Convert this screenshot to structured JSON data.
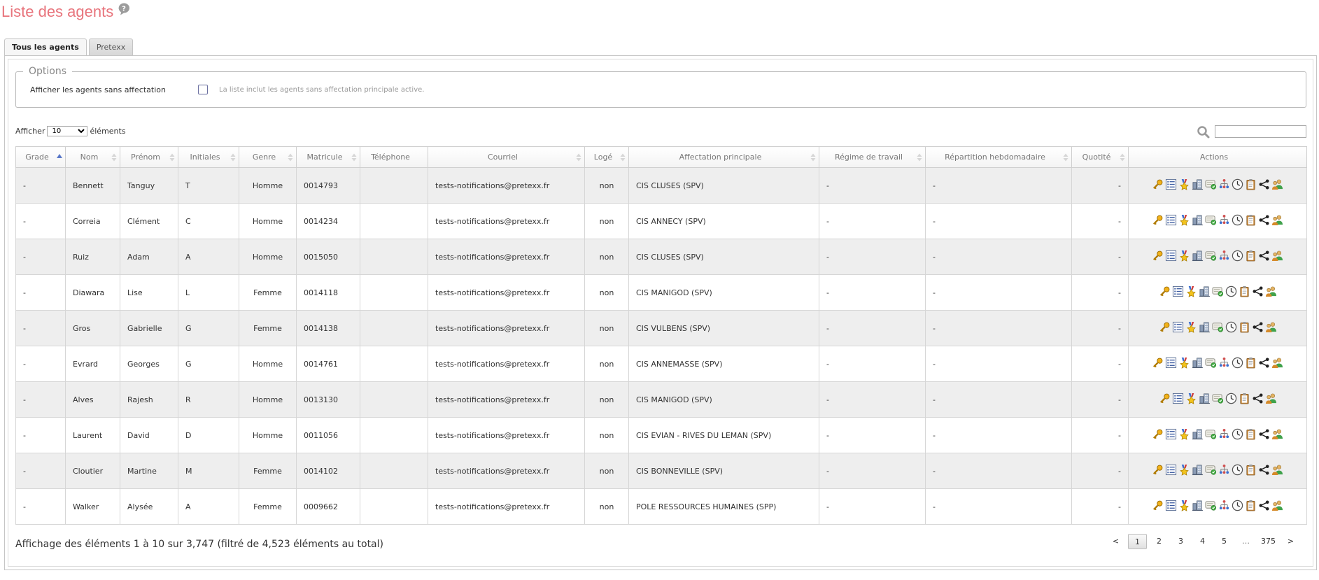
{
  "page": {
    "title": "Liste des agents"
  },
  "tabs": [
    "Tous les agents",
    "Pretexx"
  ],
  "options": {
    "legend": "Options",
    "checkbox_label": "Afficher les agents sans affectation",
    "hint": "La liste inclut les agents sans affectation principale active."
  },
  "length": {
    "prefix": "Afficher",
    "selected": "10",
    "suffix": "éléments"
  },
  "search": {
    "value": ""
  },
  "table": {
    "columns": [
      "Grade",
      "Nom",
      "Prénom",
      "Initiales",
      "Genre",
      "Matricule",
      "Téléphone",
      "Courriel",
      "Logé",
      "Affectation principale",
      "Régime de travail",
      "Répartition hebdomadaire",
      "Quotité",
      "Actions"
    ],
    "rows": [
      {
        "grade": "-",
        "nom": "Bennett",
        "prenom": "Tanguy",
        "init": "T",
        "genre": "Homme",
        "mat": "0014793",
        "tel": "",
        "mail": "tests-notifications@pretexx.fr",
        "loge": "non",
        "aff": "CIS CLUSES (SPV)",
        "regime": "-",
        "repart": "-",
        "quot": "-"
      },
      {
        "grade": "-",
        "nom": "Correia",
        "prenom": "Clément",
        "init": "C",
        "genre": "Homme",
        "mat": "0014234",
        "tel": "",
        "mail": "tests-notifications@pretexx.fr",
        "loge": "non",
        "aff": "CIS ANNECY (SPV)",
        "regime": "-",
        "repart": "-",
        "quot": "-"
      },
      {
        "grade": "-",
        "nom": "Ruiz",
        "prenom": "Adam",
        "init": "A",
        "genre": "Homme",
        "mat": "0015050",
        "tel": "",
        "mail": "tests-notifications@pretexx.fr",
        "loge": "non",
        "aff": "CIS CLUSES (SPV)",
        "regime": "-",
        "repart": "-",
        "quot": "-"
      },
      {
        "grade": "-",
        "nom": "Diawara",
        "prenom": "Lise",
        "init": "L",
        "genre": "Femme",
        "mat": "0014118",
        "tel": "",
        "mail": "tests-notifications@pretexx.fr",
        "loge": "non",
        "aff": "CIS MANIGOD (SPV)",
        "regime": "-",
        "repart": "-",
        "quot": "-"
      },
      {
        "grade": "-",
        "nom": "Gros",
        "prenom": "Gabrielle",
        "init": "G",
        "genre": "Femme",
        "mat": "0014138",
        "tel": "",
        "mail": "tests-notifications@pretexx.fr",
        "loge": "non",
        "aff": "CIS VULBENS (SPV)",
        "regime": "-",
        "repart": "-",
        "quot": "-"
      },
      {
        "grade": "-",
        "nom": "Evrard",
        "prenom": "Georges",
        "init": "G",
        "genre": "Homme",
        "mat": "0014761",
        "tel": "",
        "mail": "tests-notifications@pretexx.fr",
        "loge": "non",
        "aff": "CIS ANNEMASSE (SPV)",
        "regime": "-",
        "repart": "-",
        "quot": "-"
      },
      {
        "grade": "-",
        "nom": "Alves",
        "prenom": "Rajesh",
        "init": "R",
        "genre": "Homme",
        "mat": "0013130",
        "tel": "",
        "mail": "tests-notifications@pretexx.fr",
        "loge": "non",
        "aff": "CIS MANIGOD (SPV)",
        "regime": "-",
        "repart": "-",
        "quot": "-"
      },
      {
        "grade": "-",
        "nom": "Laurent",
        "prenom": "David",
        "init": "D",
        "genre": "Homme",
        "mat": "0011056",
        "tel": "",
        "mail": "tests-notifications@pretexx.fr",
        "loge": "non",
        "aff": "CIS EVIAN - RIVES DU LEMAN (SPV)",
        "regime": "-",
        "repart": "-",
        "quot": "-"
      },
      {
        "grade": "-",
        "nom": "Cloutier",
        "prenom": "Martine",
        "init": "M",
        "genre": "Femme",
        "mat": "0014102",
        "tel": "",
        "mail": "tests-notifications@pretexx.fr",
        "loge": "non",
        "aff": "CIS BONNEVILLE (SPV)",
        "regime": "-",
        "repart": "-",
        "quot": "-"
      },
      {
        "grade": "-",
        "nom": "Walker",
        "prenom": "Alysée",
        "init": "A",
        "genre": "Femme",
        "mat": "0009662",
        "tel": "",
        "mail": "tests-notifications@pretexx.fr",
        "loge": "non",
        "aff": "POLE RESSOURCES HUMAINES (SPP)",
        "regime": "-",
        "repart": "-",
        "quot": "-"
      }
    ]
  },
  "action_icons": {
    "full": [
      "key-icon",
      "list-icon",
      "medal-icon",
      "building-icon",
      "certificate-icon",
      "org-chart-icon",
      "clock-icon",
      "clipboard-icon",
      "share-icon",
      "users-icon"
    ],
    "short": [
      "key-icon",
      "list-icon",
      "medal-icon",
      "building-icon",
      "certificate-icon",
      "clock-icon",
      "clipboard-icon",
      "share-icon",
      "users-icon"
    ],
    "short_rows": [
      3,
      4,
      6
    ]
  },
  "footer": {
    "info": "Affichage des éléments 1 à 10 sur 3,747 (filtré de 4,523 éléments au total)",
    "pages": [
      "<",
      "1",
      "2",
      "3",
      "4",
      "5",
      "…",
      "375",
      ">"
    ],
    "current": "1"
  },
  "colors": {
    "title": "#e8747c",
    "row_odd": "#eeeeee",
    "row_even": "#ffffff"
  }
}
